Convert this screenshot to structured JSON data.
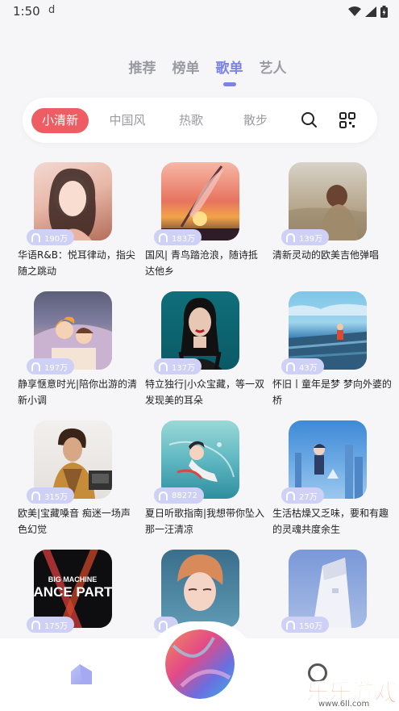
{
  "status": {
    "time": "1:50",
    "d_icon": "d"
  },
  "top_tabs": [
    {
      "label": "推荐"
    },
    {
      "label": "榜单"
    },
    {
      "label": "歌单"
    },
    {
      "label": "艺人"
    }
  ],
  "active_top_tab": "歌单",
  "filters": [
    {
      "label": "小清新"
    },
    {
      "label": "中国风"
    },
    {
      "label": "热歌"
    },
    {
      "label": "散步"
    }
  ],
  "active_filter": "小清新",
  "playlists": [
    {
      "plays": "190万",
      "title": "华语R&B：悦耳律动，指尖随之跳动"
    },
    {
      "plays": "183万",
      "title": "国风| 青鸟踏沧浪，随诗抵达他乡"
    },
    {
      "plays": "139万",
      "title": "清新灵动的欧美吉他弹唱"
    },
    {
      "plays": "197万",
      "title": "静享惬意时光|陪你出游的清新小调"
    },
    {
      "plays": "137万",
      "title": "特立独行|小众宝藏，等一双发现美的耳朵"
    },
    {
      "plays": "43万",
      "title": "怀旧丨童年是梦 梦向外婆的桥"
    },
    {
      "plays": "315万",
      "title": "欧美|宝藏嗓音 痴迷一场声色幻觉"
    },
    {
      "plays": "88272",
      "title": "夏日听歌指南|我想带你坠入那一汪清凉"
    },
    {
      "plays": "27万",
      "title": "生活枯燥又乏味，要和有趣的灵魂共度余生"
    },
    {
      "plays": "175万",
      "title": ""
    },
    {
      "plays": "",
      "title": ""
    },
    {
      "plays": "150万",
      "title": ""
    }
  ],
  "cover_texts": {
    "big_machine": "BIG MACHINE",
    "dance_party": "DANCE PARTY"
  },
  "watermark": {
    "text": "乐乐游戏",
    "url": "www.6ll.com"
  },
  "icons": [
    "search-icon",
    "qr-scan-icon",
    "headphones-icon",
    "home-icon",
    "profile-icon",
    "wifi-icon",
    "signal-icon",
    "battery-icon"
  ]
}
